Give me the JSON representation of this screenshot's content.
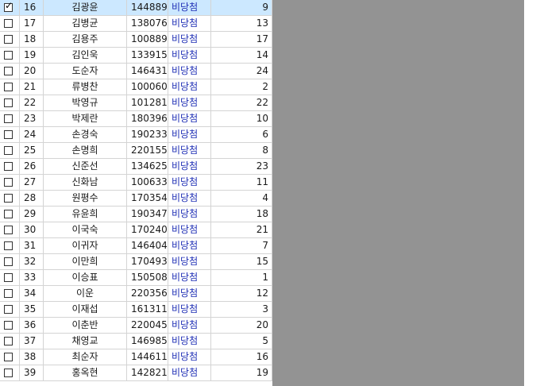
{
  "rows": [
    {
      "checked": true,
      "num": "16",
      "name": "김광윤",
      "code": "144889",
      "status": "비당첨",
      "count": "9",
      "selected": true
    },
    {
      "checked": false,
      "num": "17",
      "name": "김병균",
      "code": "138076",
      "status": "비당첨",
      "count": "13"
    },
    {
      "checked": false,
      "num": "18",
      "name": "김용주",
      "code": "100889",
      "status": "비당첨",
      "count": "17"
    },
    {
      "checked": false,
      "num": "19",
      "name": "김인욱",
      "code": "133915",
      "status": "비당첨",
      "count": "14"
    },
    {
      "checked": false,
      "num": "20",
      "name": "도순자",
      "code": "146431",
      "status": "비당첨",
      "count": "24"
    },
    {
      "checked": false,
      "num": "21",
      "name": "류병찬",
      "code": "100060",
      "status": "비당첨",
      "count": "2"
    },
    {
      "checked": false,
      "num": "22",
      "name": "박영규",
      "code": "101281",
      "status": "비당첨",
      "count": "22"
    },
    {
      "checked": false,
      "num": "23",
      "name": "박제란",
      "code": "180396",
      "status": "비당첨",
      "count": "10"
    },
    {
      "checked": false,
      "num": "24",
      "name": "손경숙",
      "code": "190233",
      "status": "비당첨",
      "count": "6"
    },
    {
      "checked": false,
      "num": "25",
      "name": "손명희",
      "code": "220155",
      "status": "비당첨",
      "count": "8"
    },
    {
      "checked": false,
      "num": "26",
      "name": "신준선",
      "code": "134625",
      "status": "비당첨",
      "count": "23"
    },
    {
      "checked": false,
      "num": "27",
      "name": "신화남",
      "code": "100633",
      "status": "비당첨",
      "count": "11"
    },
    {
      "checked": false,
      "num": "28",
      "name": "원평수",
      "code": "170354",
      "status": "비당첨",
      "count": "4"
    },
    {
      "checked": false,
      "num": "29",
      "name": "유윤희",
      "code": "190347",
      "status": "비당첨",
      "count": "18"
    },
    {
      "checked": false,
      "num": "30",
      "name": "이국숙",
      "code": "170240",
      "status": "비당첨",
      "count": "21"
    },
    {
      "checked": false,
      "num": "31",
      "name": "이귀자",
      "code": "146404",
      "status": "비당첨",
      "count": "7"
    },
    {
      "checked": false,
      "num": "32",
      "name": "이만희",
      "code": "170493",
      "status": "비당첨",
      "count": "15"
    },
    {
      "checked": false,
      "num": "33",
      "name": "이승표",
      "code": "150508",
      "status": "비당첨",
      "count": "1"
    },
    {
      "checked": false,
      "num": "34",
      "name": "이운",
      "code": "220356",
      "status": "비당첨",
      "count": "12"
    },
    {
      "checked": false,
      "num": "35",
      "name": "이재섭",
      "code": "161311",
      "status": "비당첨",
      "count": "3"
    },
    {
      "checked": false,
      "num": "36",
      "name": "이춘반",
      "code": "220045",
      "status": "비당첨",
      "count": "20"
    },
    {
      "checked": false,
      "num": "37",
      "name": "채영교",
      "code": "146985",
      "status": "비당첨",
      "count": "5"
    },
    {
      "checked": false,
      "num": "38",
      "name": "최순자",
      "code": "144611",
      "status": "비당첨",
      "count": "16"
    },
    {
      "checked": false,
      "num": "39",
      "name": "홍옥현",
      "code": "142821",
      "status": "비당첨",
      "count": "19"
    }
  ],
  "colors": {
    "selected_row": "#cce8ff",
    "status_text": "#1f2fb5",
    "empty_area": "#939393",
    "grid_line": "#d4d4d4"
  }
}
